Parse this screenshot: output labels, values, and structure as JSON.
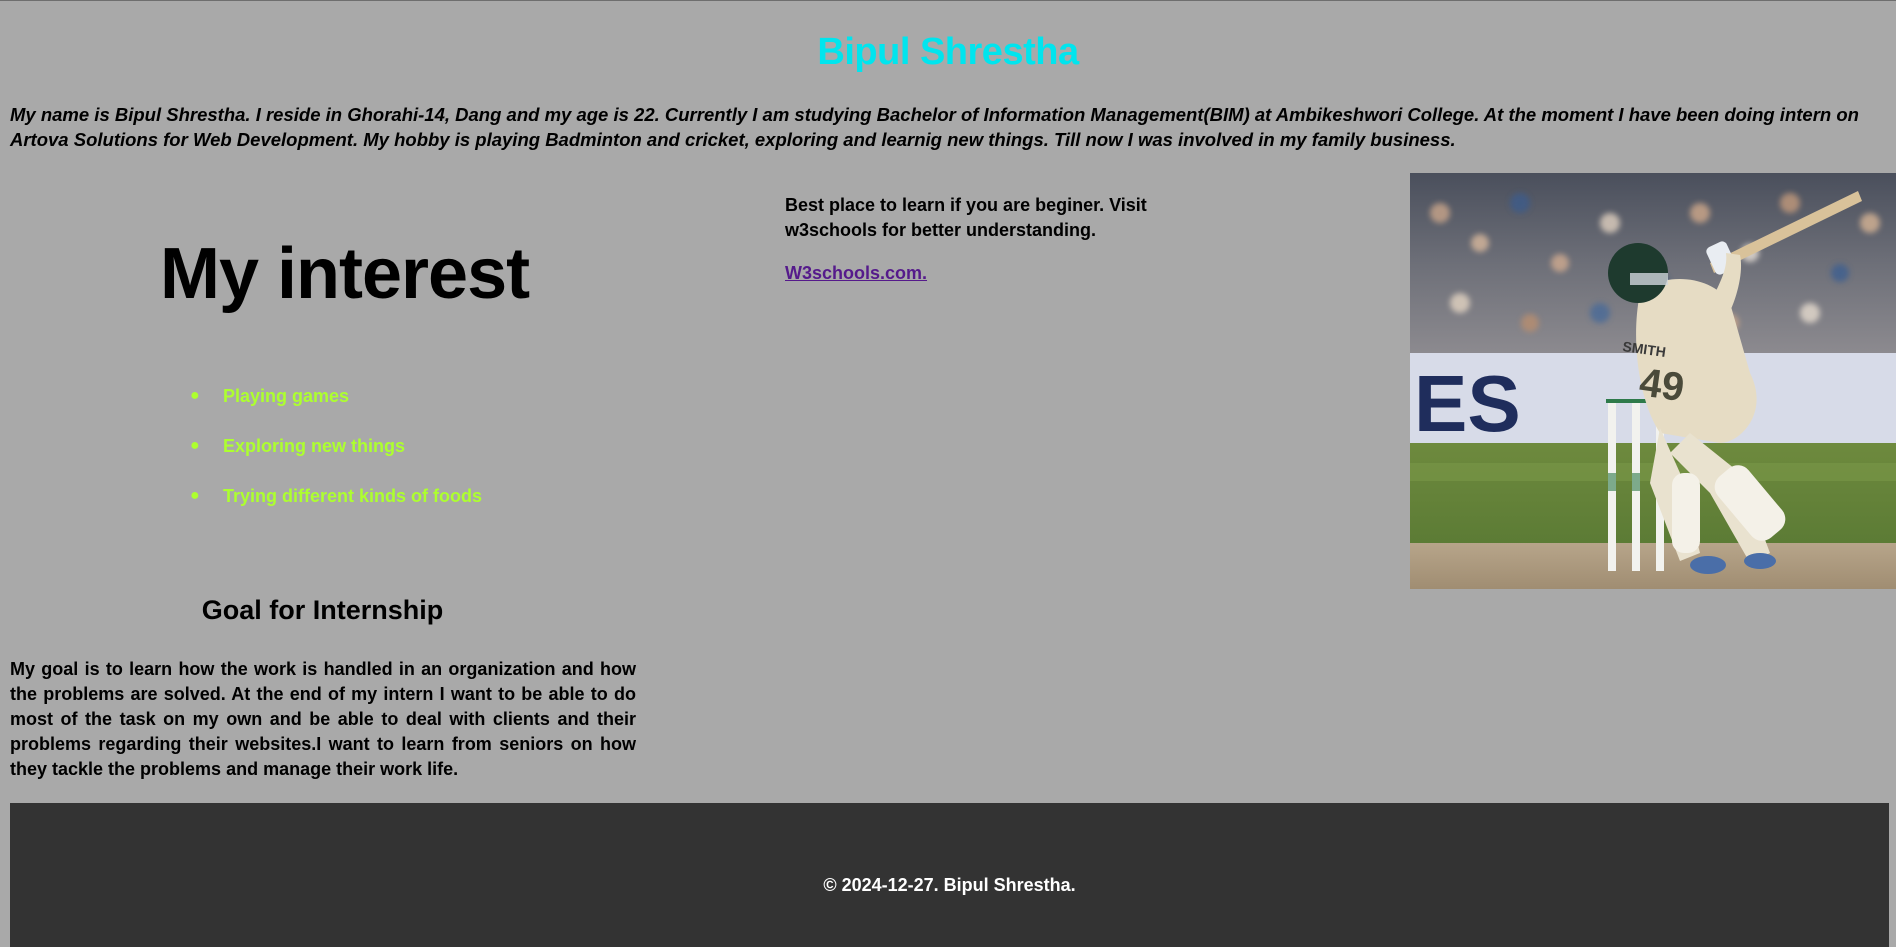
{
  "header": {
    "title": "Bipul Shrestha"
  },
  "intro": {
    "text": "My name is Bipul Shrestha. I reside in Ghorahi-14, Dang and my age is 22. Currently I am studying Bachelor of Information Management(BIM) at Ambikeshwori College. At the moment I have been doing intern on Artova Solutions for Web Development. My hobby is playing Badminton and cricket, exploring and learnig new things. Till now I was involved in my family business."
  },
  "interests": {
    "heading": "My interest",
    "items": [
      "Playing games",
      "Exploring new things",
      "Trying different kinds of foods"
    ]
  },
  "goal": {
    "heading": "Goal for Internship",
    "text": "My goal is to learn how the work is handled in an organization and how the problems are solved. At the end of my intern I want to be able to do most of the task on my own and be able to deal with clients and their problems regarding their websites.I want to learn from seniors on how they tackle the problems and manage their work life."
  },
  "resource": {
    "text": "Best place to learn if you are beginer. Visit w3schools for better understanding.",
    "link_label": "W3schools.com."
  },
  "photo": {
    "jersey_name": "SMITH",
    "jersey_number": "49",
    "board_text": "ES"
  },
  "footer": {
    "text": "© 2024-12-27. Bipul Shrestha."
  },
  "colors": {
    "page_background": "#a9a9a9",
    "title": "#00e5ee",
    "list_items": "#adff2f",
    "link": "#551a8b",
    "footer_background": "#333333"
  }
}
